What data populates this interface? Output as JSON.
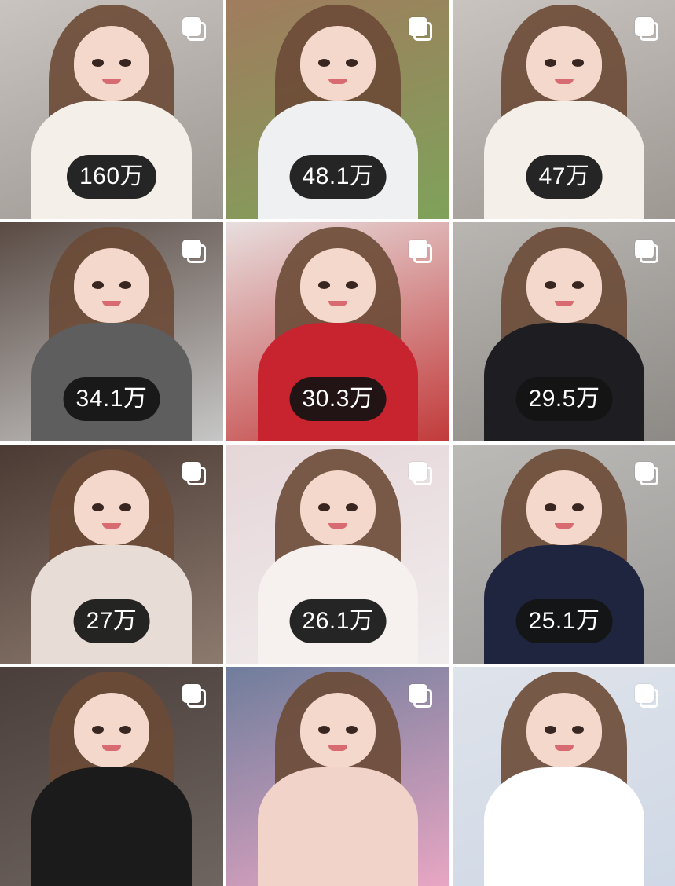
{
  "grid": {
    "posts": [
      {
        "count": "160万",
        "bg": [
          "#c9c4c0",
          "#9e9893"
        ],
        "outfit": "#f4efe8",
        "multi": true
      },
      {
        "count": "48.1万",
        "bg": [
          "#a07c5e",
          "#7fa25a"
        ],
        "outfit": "#eef0f2",
        "multi": true
      },
      {
        "count": "47万",
        "bg": [
          "#c9c4c0",
          "#9e9893"
        ],
        "outfit": "#f4efe8",
        "multi": true
      },
      {
        "count": "34.1万",
        "bg": [
          "#5a4b44",
          "#c7c7c7"
        ],
        "outfit": "#5e5e5e",
        "multi": true
      },
      {
        "count": "30.3万",
        "bg": [
          "#e8dede",
          "#c23a3a"
        ],
        "outfit": "#c8242f",
        "multi": true
      },
      {
        "count": "29.5万",
        "bg": [
          "#b9b6b2",
          "#8d8a86"
        ],
        "outfit": "#1d1d22",
        "multi": true
      },
      {
        "count": "27万",
        "bg": [
          "#4b3a33",
          "#8c7a6f"
        ],
        "outfit": "#e7dcd6",
        "multi": true
      },
      {
        "count": "26.1万",
        "bg": [
          "#e6d6d8",
          "#f0eced"
        ],
        "outfit": "#f6f1ef",
        "multi": true
      },
      {
        "count": "25.1万",
        "bg": [
          "#bcbab7",
          "#9c9a98"
        ],
        "outfit": "#20253f",
        "multi": true
      },
      {
        "count": "",
        "bg": [
          "#4a3f3a",
          "#6e6460"
        ],
        "outfit": "#1b1b1b",
        "multi": true
      },
      {
        "count": "",
        "bg": [
          "#6f7d9c",
          "#e8a6c3"
        ],
        "outfit": "#f1d3c9",
        "multi": true
      },
      {
        "count": "",
        "bg": [
          "#dfe3ea",
          "#cfd8e6"
        ],
        "outfit": "#ffffff",
        "multi": true
      }
    ]
  }
}
